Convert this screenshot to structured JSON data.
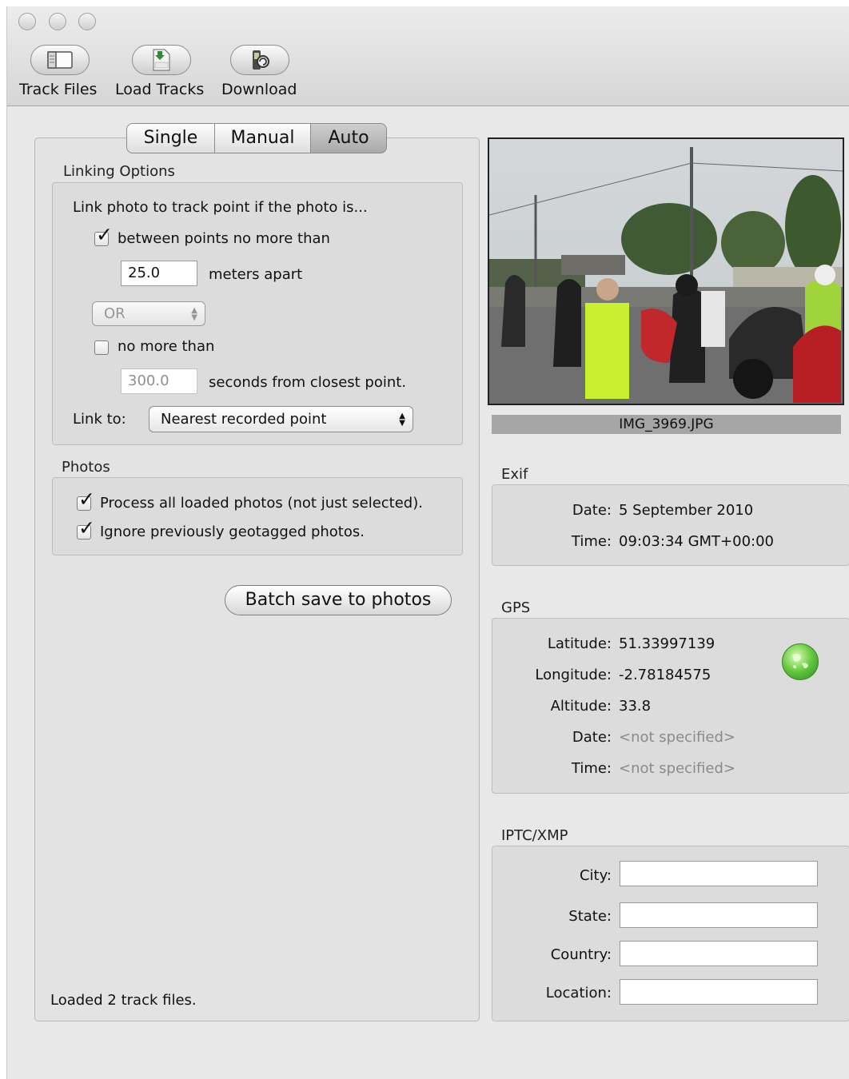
{
  "toolbar": {
    "buttons": [
      {
        "label": "Track Files",
        "icon": "sidebar-icon"
      },
      {
        "label": "Load Tracks",
        "icon": "gpx-file-icon"
      },
      {
        "label": "Download",
        "icon": "download-icon"
      }
    ]
  },
  "mode_tabs": [
    "Single",
    "Manual",
    "Auto"
  ],
  "selected_tab": "Auto",
  "linking_options": {
    "title": "Linking Options",
    "intro": "Link photo to track point if the photo is...",
    "between_points_label": "between points no more than",
    "between_points_checked": true,
    "distance_value": "25.0",
    "distance_unit": "meters apart",
    "operator": "OR",
    "no_more_than_label": "no more than",
    "no_more_than_checked": false,
    "seconds_value": "300.0",
    "seconds_unit": "seconds from closest point.",
    "link_to_label": "Link to:",
    "link_to_value": "Nearest recorded point"
  },
  "photos": {
    "title": "Photos",
    "process_all_label": "Process all loaded photos (not just selected).",
    "process_all_checked": true,
    "ignore_label": "Ignore previously geotagged photos.",
    "ignore_checked": true
  },
  "batch_save_label": "Batch save to photos",
  "status_text": "Loaded 2 track files.",
  "photo_caption": "IMG_3969.JPG",
  "exif": {
    "title": "Exif",
    "date_label": "Date:",
    "date_value": "5 September 2010",
    "time_label": "Time:",
    "time_value": "09:03:34 GMT+00:00"
  },
  "gps": {
    "title": "GPS",
    "latitude_label": "Latitude:",
    "latitude_value": "51.33997139",
    "longitude_label": "Longitude:",
    "longitude_value": "-2.78184575",
    "altitude_label": "Altitude:",
    "altitude_value": "33.8",
    "date_label": "Date:",
    "date_value": "<not specified>",
    "time_label": "Time:",
    "time_value": "<not specified>",
    "globe_icon": "globe-icon"
  },
  "iptc": {
    "title": "IPTC/XMP",
    "city_label": "City:",
    "city_value": "",
    "state_label": "State:",
    "state_value": "",
    "country_label": "Country:",
    "country_value": "",
    "location_label": "Location:",
    "location_value": ""
  }
}
